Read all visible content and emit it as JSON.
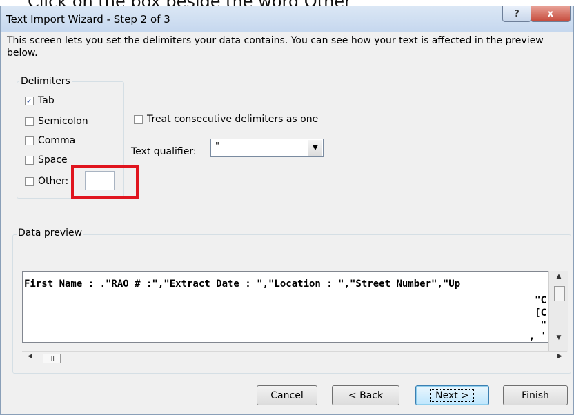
{
  "instruction": "Click on the box beside the word Other",
  "window": {
    "title": "Text Import Wizard - Step 2 of 3",
    "help_glyph": "?",
    "close_glyph": "x"
  },
  "description": "This screen lets you set the delimiters your data contains.  You can see how your text is affected in the preview below.",
  "delimiters": {
    "group_label": "Delimiters",
    "items": [
      {
        "label": "Tab",
        "checked": true
      },
      {
        "label": "Semicolon",
        "checked": false
      },
      {
        "label": "Comma",
        "checked": false
      },
      {
        "label": "Space",
        "checked": false
      },
      {
        "label": "Other:",
        "checked": false
      }
    ],
    "other_value": ""
  },
  "consecutive": {
    "label": "Treat consecutive delimiters as one",
    "checked": false
  },
  "qualifier": {
    "label": "Text qualifier:",
    "value": "\""
  },
  "preview": {
    "group_label": "Data preview",
    "line1": "First Name : .\"RAO # :\",\"Extract Date : \",\"Location : \",\"Street Number\",\"Up",
    "fragments": [
      "\"C",
      "[C",
      "\"",
      "\"",
      ", '"
    ]
  },
  "buttons": {
    "cancel": "Cancel",
    "back": "< Back",
    "next": "Next >",
    "finish": "Finish"
  },
  "highlight_color": "#e0141e"
}
